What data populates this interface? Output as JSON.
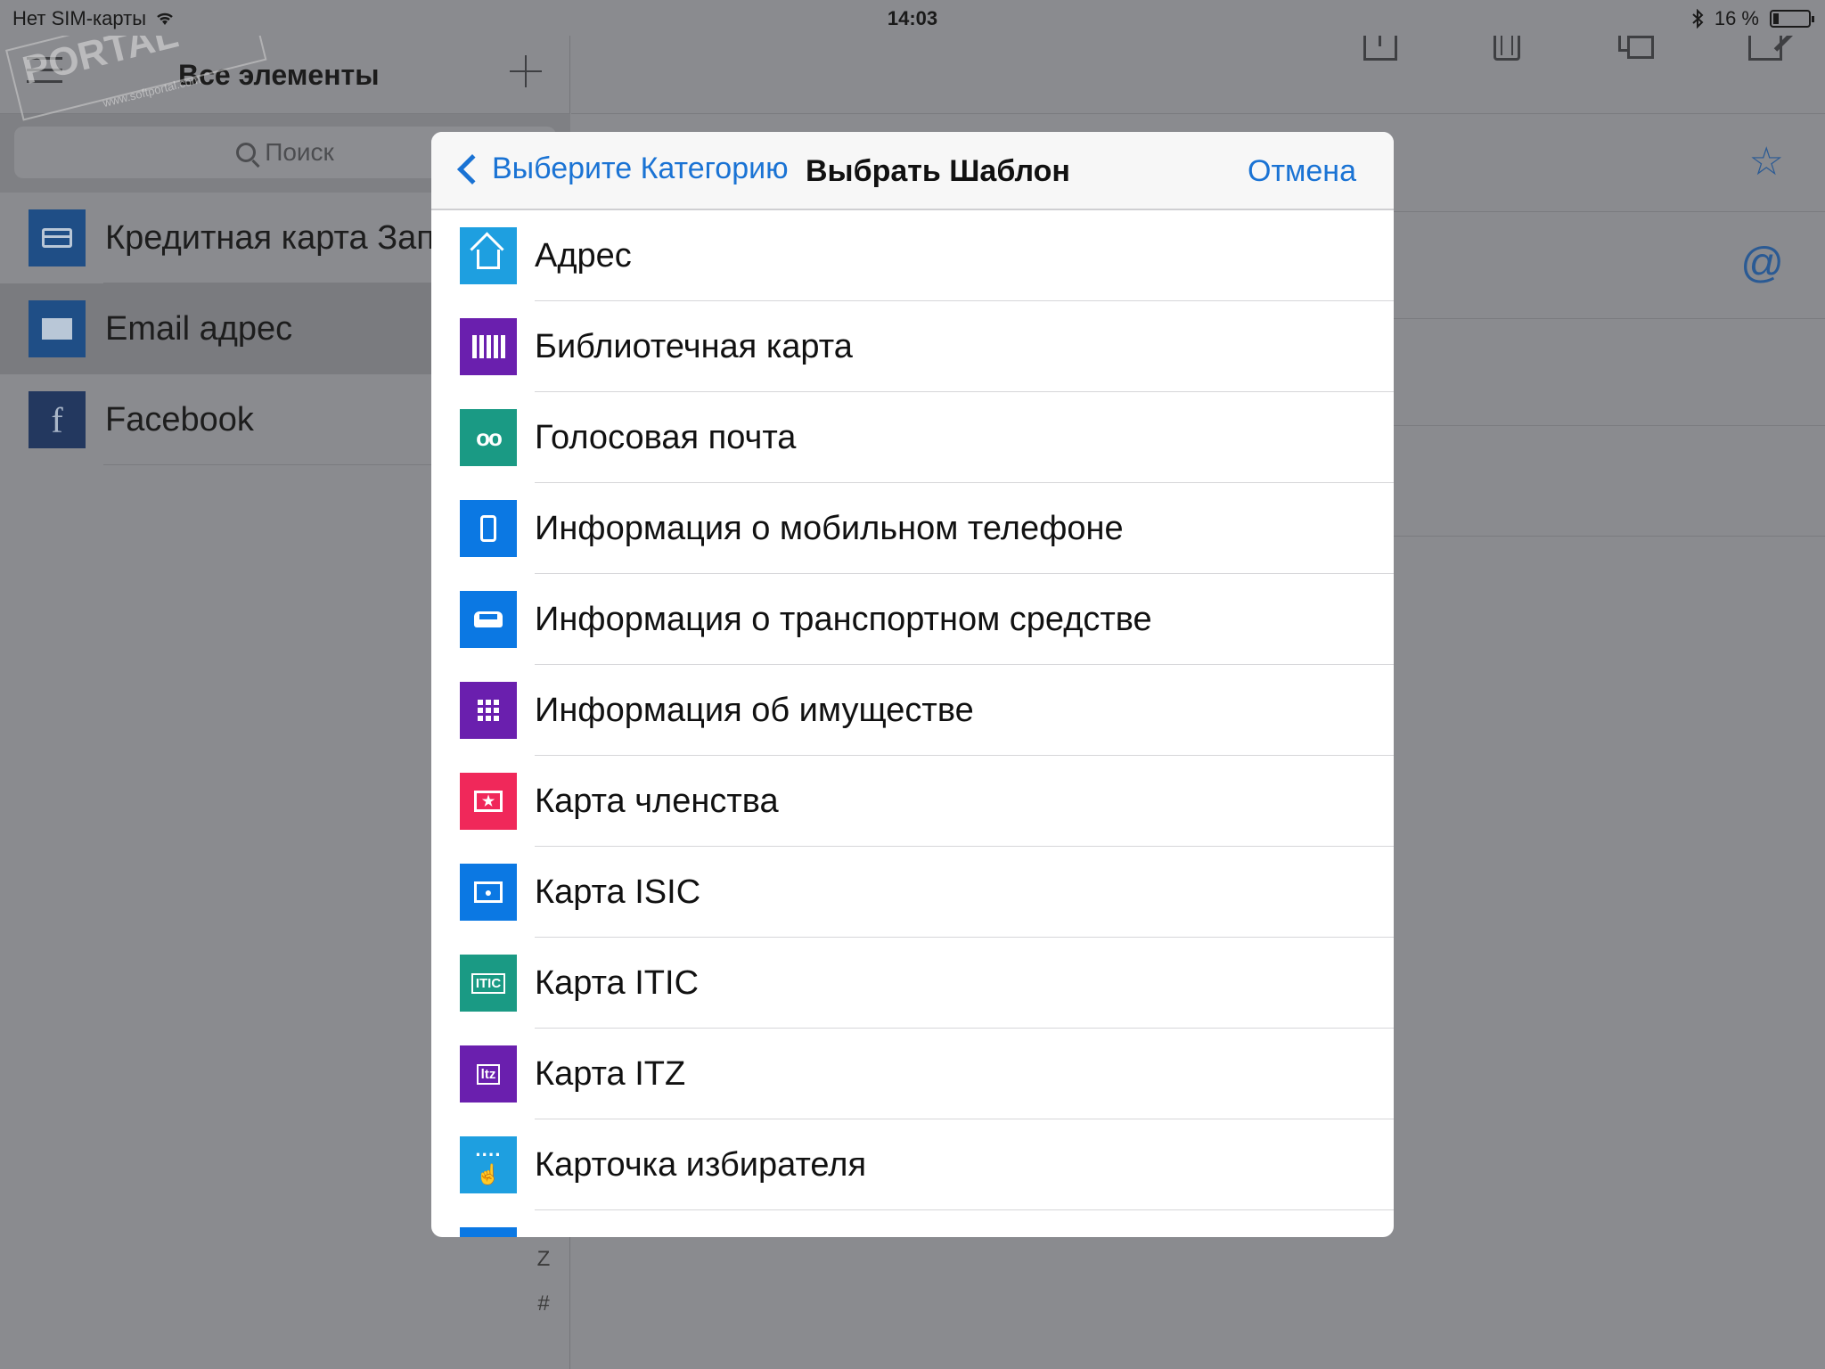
{
  "status_bar": {
    "carrier": "Нет SIM-карты",
    "time": "14:03",
    "battery": "16 %"
  },
  "watermark": {
    "text": "PORTAL",
    "url": "www.softportal.com"
  },
  "left_panel": {
    "title": "Все элементы",
    "search_placeholder": "Поиск",
    "items": [
      {
        "label": "Кредитная карта Зап",
        "icon": "credit-card-icon",
        "color": "#1f4e86"
      },
      {
        "label": "Email адрес",
        "icon": "mail-icon",
        "color": "#1f4e86"
      },
      {
        "label": "Facebook",
        "icon": "facebook-icon",
        "color": "#23385f"
      }
    ],
    "index_letters": [
      "Z",
      "#"
    ]
  },
  "right_toolbar": {
    "icons": [
      "share-icon",
      "trash-icon",
      "copy-icon",
      "edit-icon"
    ]
  },
  "right_detail_icons": [
    "star-icon",
    "at-icon",
    "eye-icon"
  ],
  "modal": {
    "back_label": "Выберите Категорию",
    "title": "Выбрать Шаблон",
    "cancel_label": "Отмена",
    "templates": [
      {
        "label": "Адрес",
        "icon": "home-icon",
        "color": "#1e9fe0"
      },
      {
        "label": "Библиотечная карта",
        "icon": "books-icon",
        "color": "#6a1fae"
      },
      {
        "label": "Голосовая почта",
        "icon": "voicemail-icon",
        "color": "#1a9a84"
      },
      {
        "label": "Информация о мобильном телефоне",
        "icon": "mobile-phone-icon",
        "color": "#0b78e3"
      },
      {
        "label": "Информация о транспортном средстве",
        "icon": "car-icon",
        "color": "#0b78e3"
      },
      {
        "label": "Информация об имуществе",
        "icon": "building-icon",
        "color": "#6a1fae"
      },
      {
        "label": "Карта членства",
        "icon": "membership-card-icon",
        "color": "#f0285a"
      },
      {
        "label": "Карта ISIC",
        "icon": "isic-card-icon",
        "color": "#0b78e3"
      },
      {
        "label": "Карта ITIC",
        "icon": "itic-card-icon",
        "color": "#1a9a84",
        "icon_text": "ITIC"
      },
      {
        "label": "Карта ITZ",
        "icon": "itz-card-icon",
        "color": "#6a1fae",
        "icon_text": "ltz"
      },
      {
        "label": "Карточка избирателя",
        "icon": "dialer-card-icon",
        "color": "#1e9fe0"
      }
    ]
  }
}
